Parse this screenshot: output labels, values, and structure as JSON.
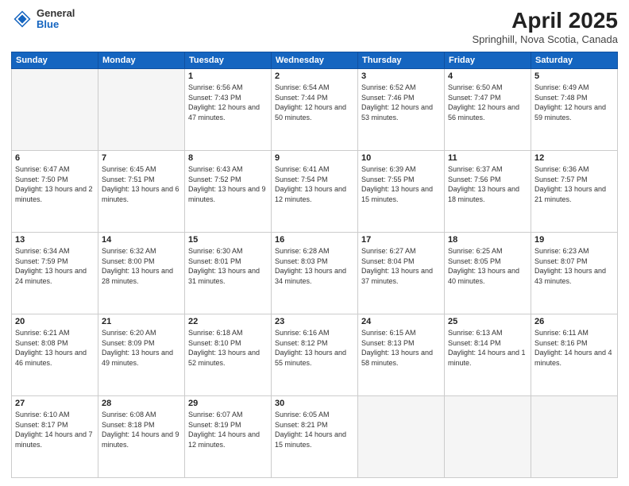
{
  "header": {
    "logo": {
      "general": "General",
      "blue": "Blue"
    },
    "title": "April 2025",
    "subtitle": "Springhill, Nova Scotia, Canada"
  },
  "weekdays": [
    "Sunday",
    "Monday",
    "Tuesday",
    "Wednesday",
    "Thursday",
    "Friday",
    "Saturday"
  ],
  "weeks": [
    [
      {
        "day": "",
        "info": ""
      },
      {
        "day": "",
        "info": ""
      },
      {
        "day": "1",
        "info": "Sunrise: 6:56 AM\nSunset: 7:43 PM\nDaylight: 12 hours and 47 minutes."
      },
      {
        "day": "2",
        "info": "Sunrise: 6:54 AM\nSunset: 7:44 PM\nDaylight: 12 hours and 50 minutes."
      },
      {
        "day": "3",
        "info": "Sunrise: 6:52 AM\nSunset: 7:46 PM\nDaylight: 12 hours and 53 minutes."
      },
      {
        "day": "4",
        "info": "Sunrise: 6:50 AM\nSunset: 7:47 PM\nDaylight: 12 hours and 56 minutes."
      },
      {
        "day": "5",
        "info": "Sunrise: 6:49 AM\nSunset: 7:48 PM\nDaylight: 12 hours and 59 minutes."
      }
    ],
    [
      {
        "day": "6",
        "info": "Sunrise: 6:47 AM\nSunset: 7:50 PM\nDaylight: 13 hours and 2 minutes."
      },
      {
        "day": "7",
        "info": "Sunrise: 6:45 AM\nSunset: 7:51 PM\nDaylight: 13 hours and 6 minutes."
      },
      {
        "day": "8",
        "info": "Sunrise: 6:43 AM\nSunset: 7:52 PM\nDaylight: 13 hours and 9 minutes."
      },
      {
        "day": "9",
        "info": "Sunrise: 6:41 AM\nSunset: 7:54 PM\nDaylight: 13 hours and 12 minutes."
      },
      {
        "day": "10",
        "info": "Sunrise: 6:39 AM\nSunset: 7:55 PM\nDaylight: 13 hours and 15 minutes."
      },
      {
        "day": "11",
        "info": "Sunrise: 6:37 AM\nSunset: 7:56 PM\nDaylight: 13 hours and 18 minutes."
      },
      {
        "day": "12",
        "info": "Sunrise: 6:36 AM\nSunset: 7:57 PM\nDaylight: 13 hours and 21 minutes."
      }
    ],
    [
      {
        "day": "13",
        "info": "Sunrise: 6:34 AM\nSunset: 7:59 PM\nDaylight: 13 hours and 24 minutes."
      },
      {
        "day": "14",
        "info": "Sunrise: 6:32 AM\nSunset: 8:00 PM\nDaylight: 13 hours and 28 minutes."
      },
      {
        "day": "15",
        "info": "Sunrise: 6:30 AM\nSunset: 8:01 PM\nDaylight: 13 hours and 31 minutes."
      },
      {
        "day": "16",
        "info": "Sunrise: 6:28 AM\nSunset: 8:03 PM\nDaylight: 13 hours and 34 minutes."
      },
      {
        "day": "17",
        "info": "Sunrise: 6:27 AM\nSunset: 8:04 PM\nDaylight: 13 hours and 37 minutes."
      },
      {
        "day": "18",
        "info": "Sunrise: 6:25 AM\nSunset: 8:05 PM\nDaylight: 13 hours and 40 minutes."
      },
      {
        "day": "19",
        "info": "Sunrise: 6:23 AM\nSunset: 8:07 PM\nDaylight: 13 hours and 43 minutes."
      }
    ],
    [
      {
        "day": "20",
        "info": "Sunrise: 6:21 AM\nSunset: 8:08 PM\nDaylight: 13 hours and 46 minutes."
      },
      {
        "day": "21",
        "info": "Sunrise: 6:20 AM\nSunset: 8:09 PM\nDaylight: 13 hours and 49 minutes."
      },
      {
        "day": "22",
        "info": "Sunrise: 6:18 AM\nSunset: 8:10 PM\nDaylight: 13 hours and 52 minutes."
      },
      {
        "day": "23",
        "info": "Sunrise: 6:16 AM\nSunset: 8:12 PM\nDaylight: 13 hours and 55 minutes."
      },
      {
        "day": "24",
        "info": "Sunrise: 6:15 AM\nSunset: 8:13 PM\nDaylight: 13 hours and 58 minutes."
      },
      {
        "day": "25",
        "info": "Sunrise: 6:13 AM\nSunset: 8:14 PM\nDaylight: 14 hours and 1 minute."
      },
      {
        "day": "26",
        "info": "Sunrise: 6:11 AM\nSunset: 8:16 PM\nDaylight: 14 hours and 4 minutes."
      }
    ],
    [
      {
        "day": "27",
        "info": "Sunrise: 6:10 AM\nSunset: 8:17 PM\nDaylight: 14 hours and 7 minutes."
      },
      {
        "day": "28",
        "info": "Sunrise: 6:08 AM\nSunset: 8:18 PM\nDaylight: 14 hours and 9 minutes."
      },
      {
        "day": "29",
        "info": "Sunrise: 6:07 AM\nSunset: 8:19 PM\nDaylight: 14 hours and 12 minutes."
      },
      {
        "day": "30",
        "info": "Sunrise: 6:05 AM\nSunset: 8:21 PM\nDaylight: 14 hours and 15 minutes."
      },
      {
        "day": "",
        "info": ""
      },
      {
        "day": "",
        "info": ""
      },
      {
        "day": "",
        "info": ""
      }
    ]
  ]
}
